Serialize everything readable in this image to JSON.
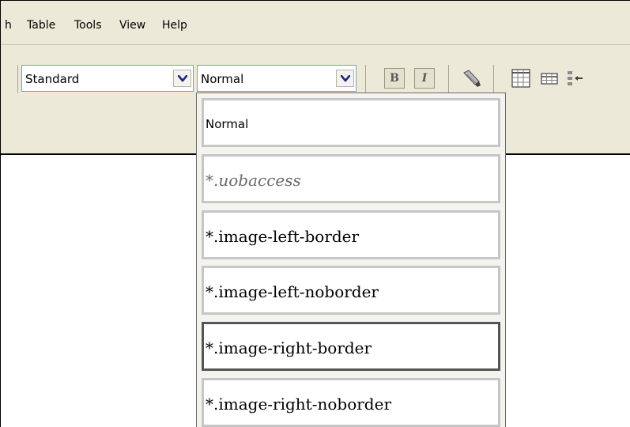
{
  "menubar": {
    "items": [
      "h",
      "Table",
      "Tools",
      "View",
      "Help"
    ]
  },
  "toolbar": {
    "font_combo": {
      "value": "Standard"
    },
    "style_combo": {
      "value": "Normal"
    },
    "bold_label": "B",
    "italic_label": "I",
    "icons": [
      "paint-brush-icon",
      "table-icon",
      "table-insert-icon",
      "outdent-icon"
    ]
  },
  "style_dropdown": {
    "options": [
      {
        "label": "Normal",
        "state": "normal"
      },
      {
        "label": "*.uobaccess",
        "state": "disabled"
      },
      {
        "label": "*.image-left-border",
        "state": "normal"
      },
      {
        "label": "*.image-left-noborder",
        "state": "normal"
      },
      {
        "label": "*.image-right-border",
        "state": "highlighted"
      },
      {
        "label": "*.image-right-noborder",
        "state": "normal"
      }
    ]
  },
  "colors": {
    "chrome": "#ece9d8",
    "combo_border": "#7f9db9",
    "option_border": "#c6c6c6",
    "option_selected_border": "#555555"
  }
}
